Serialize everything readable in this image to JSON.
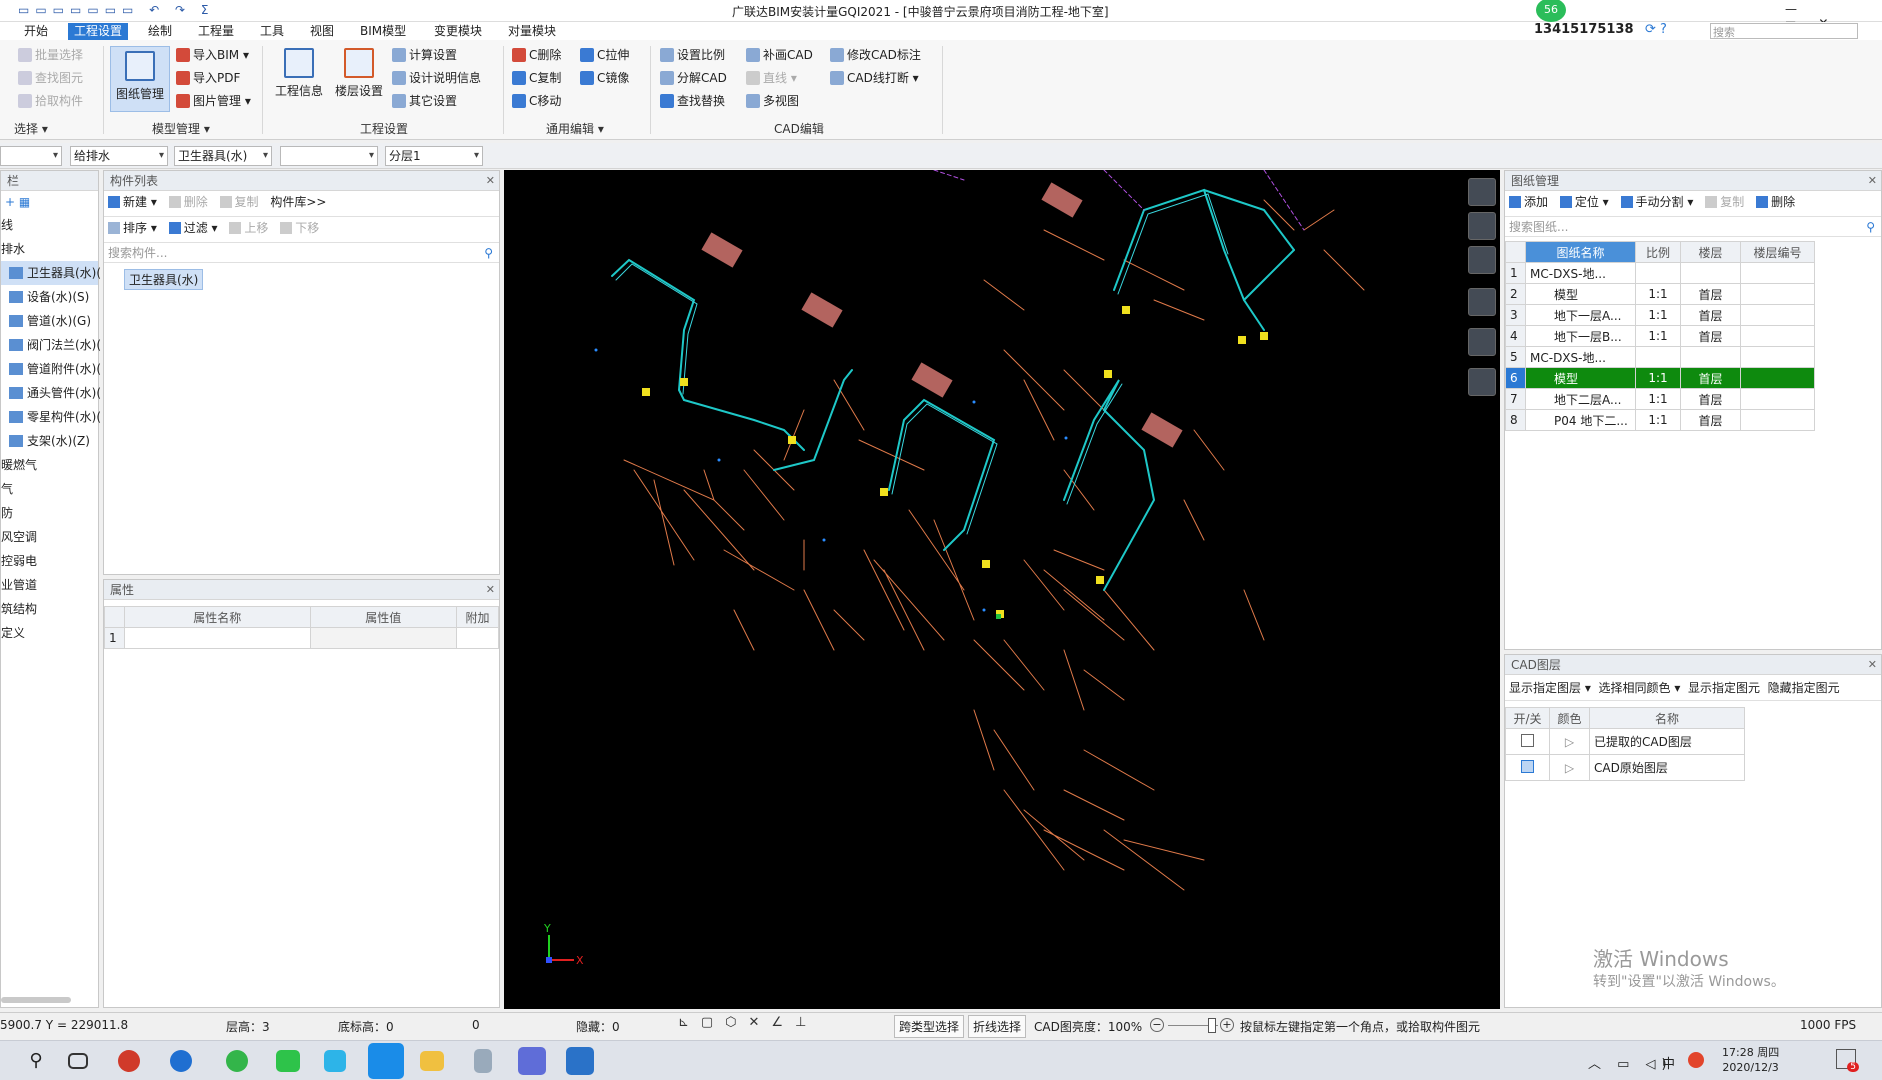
{
  "window": {
    "title": "广联达BIM安装计量GQI2021 - [中骏普宁云景府项目消防工程-地下室]",
    "badge": "56",
    "phone": "13415175138",
    "search_placeholder": "搜索",
    "help": "?"
  },
  "menus": [
    "开始",
    "工程设置",
    "绘制",
    "工程量",
    "工具",
    "视图",
    "BIM模型",
    "变更模块",
    "对量模块"
  ],
  "ribbon": {
    "select": {
      "items": [
        "批量选择",
        "查找图元",
        "拾取构件"
      ],
      "label": "选择"
    },
    "model": {
      "big": "图纸管理",
      "items": [
        "导入BIM",
        "导入PDF",
        "图片管理"
      ],
      "label": "模型管理"
    },
    "project": {
      "bigs": [
        "工程信息",
        "楼层设置"
      ],
      "items": [
        "计算设置",
        "设计说明信息",
        "其它设置"
      ],
      "label": "工程设置"
    },
    "edit": {
      "items": [
        "C删除",
        "C复制",
        "C移动",
        "C拉伸",
        "C镜像"
      ],
      "label": "通用编辑"
    },
    "cad": {
      "items": [
        "设置比例",
        "分解CAD",
        "查找替换",
        "补画CAD",
        "直线",
        "多视图",
        "修改CAD标注",
        "CAD线打断"
      ],
      "label": "CAD编辑"
    }
  },
  "combos": [
    "",
    "给排水",
    "卫生器具(水)",
    "",
    "分层1"
  ],
  "navtree": {
    "title": "栏",
    "items": [
      "线",
      "排水",
      "卫生器具(水)(",
      "设备(水)(S)",
      "管道(水)(G)",
      "阀门法兰(水)(",
      "管道附件(水)(",
      "通头管件(水)(",
      "零星构件(水)(",
      "支架(水)(Z)",
      "暖燃气",
      "气",
      "防",
      "风空调",
      "控弱电",
      "业管道",
      "筑结构",
      "定义"
    ]
  },
  "component_list": {
    "title": "构件列表",
    "toolbar1": [
      "新建",
      "删除",
      "复制",
      "构件库>>"
    ],
    "toolbar2": [
      "排序",
      "过滤",
      "上移",
      "下移"
    ],
    "search_placeholder": "搜索构件...",
    "selected": "卫生器具(水)"
  },
  "properties": {
    "title": "属性",
    "headers": [
      "属性名称",
      "属性值",
      "附加"
    ],
    "row_num": "1"
  },
  "drawing_mgmt": {
    "title": "图纸管理",
    "toolbar": [
      "添加",
      "定位",
      "手动分割",
      "复制",
      "删除"
    ],
    "search_placeholder": "搜索图纸...",
    "headers": [
      "图纸名称",
      "比例",
      "楼层",
      "楼层编号"
    ],
    "rows": [
      {
        "n": "1",
        "name": "MC-DXS-地...",
        "scale": "",
        "floor": ""
      },
      {
        "n": "2",
        "name": "模型",
        "scale": "1:1",
        "floor": "首层"
      },
      {
        "n": "3",
        "name": "地下一层A...",
        "scale": "1:1",
        "floor": "首层"
      },
      {
        "n": "4",
        "name": "地下一层B...",
        "scale": "1:1",
        "floor": "首层"
      },
      {
        "n": "5",
        "name": "MC-DXS-地...",
        "scale": "",
        "floor": ""
      },
      {
        "n": "6",
        "name": "模型",
        "scale": "1:1",
        "floor": "首层"
      },
      {
        "n": "7",
        "name": "地下二层A...",
        "scale": "1:1",
        "floor": "首层"
      },
      {
        "n": "8",
        "name": "P04 地下二...",
        "scale": "1:1",
        "floor": "首层"
      }
    ],
    "selected_row": 6
  },
  "cad_layers": {
    "title": "CAD图层",
    "toolbar": [
      "显示指定图层",
      "选择相同颜色",
      "显示指定图元",
      "隐藏指定图元"
    ],
    "headers": [
      "开/关",
      "颜色",
      "名称"
    ],
    "rows": [
      "已提取的CAD图层",
      "CAD原始图层"
    ]
  },
  "watermark": {
    "line1": "激活 Windows",
    "line2": "转到\"设置\"以激活 Windows。"
  },
  "status": {
    "coords": "5900.7 Y = 229011.8",
    "floor_height": "层高：3",
    "bottom_elev": "底标高：0",
    "zero": "0",
    "hidden": "隐藏：0",
    "cross_select": "跨类型选择",
    "polyline_select": "折线选择",
    "brightness": "CAD图亮度：100%",
    "hint": "按鼠标左键指定第一个角点，或拾取构件图元",
    "fps": "1000 FPS"
  },
  "taskbar": {
    "time": "17:28 周四",
    "date": "2020/12/3",
    "ime": "中",
    "notif": "5"
  },
  "colors": {
    "accent": "#2b79d4",
    "selected_row": "#0e8a0e",
    "pipe": "#1ec8c8",
    "cad_line": "#e07a4a",
    "fixture": "#f0e01e"
  }
}
